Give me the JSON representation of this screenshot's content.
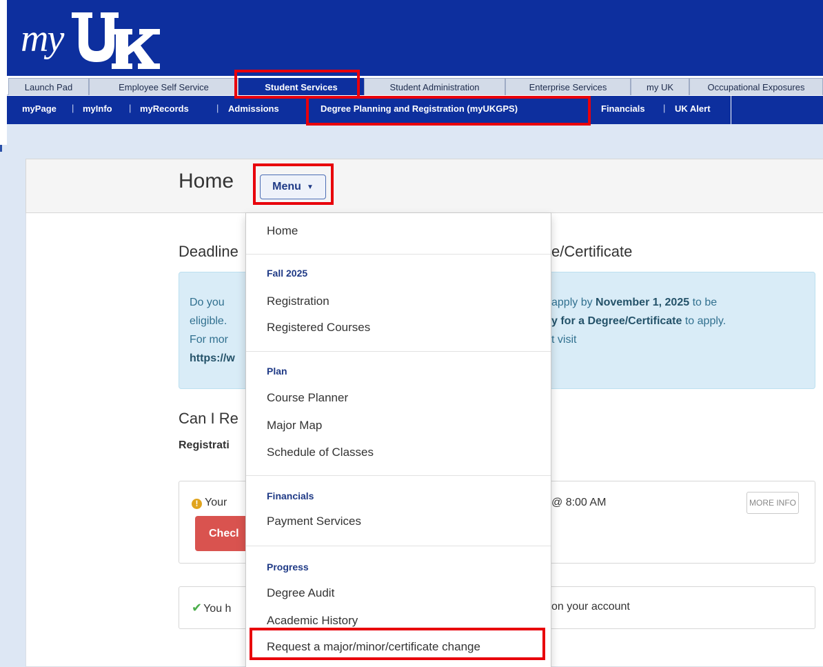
{
  "logo": {
    "prefix": "my",
    "icon": "uk-logo-icon"
  },
  "nav": {
    "tabs": [
      "Launch Pad",
      "Employee Self Service",
      "Student Services",
      "Student Administration",
      "Enterprise Services",
      "my UK",
      "Occupational Exposures"
    ],
    "active_tab": "Student Services",
    "subtabs": [
      "myPage",
      "myInfo",
      "myRecords",
      "Admissions",
      "Degree Planning and Registration (myUKGPS)",
      "Financials",
      "UK Alert"
    ],
    "separator": "|"
  },
  "page": {
    "title": "Home",
    "menu_label": "Menu",
    "deadline_heading_start": "Deadline",
    "deadline_heading_end": "e/Certificate",
    "info_lines_left": [
      "Do you",
      "eligible.",
      "For mor",
      "https://w"
    ],
    "info_line1_right_pre": "apply by ",
    "info_line1_right_bold": "November 1, 2025",
    "info_line1_right_post": " to be",
    "info_line2_right_bold": "y for a Degree/Certificate",
    "info_line2_right_post": " to apply.",
    "info_line3_right": "t visit",
    "can_heading": "Can I Re",
    "registration_label": "Registrati",
    "card1_text": "Your",
    "card1_time": "@ 8:00 AM",
    "more_info_label": "MORE INFO",
    "check_button_label": "Checl",
    "card2_text": "You h",
    "card2_tail": "on your account"
  },
  "dropdown": {
    "home": "Home",
    "sections": [
      {
        "heading": "Fall 2025",
        "items": [
          "Registration",
          "Registered Courses"
        ]
      },
      {
        "heading": "Plan",
        "items": [
          "Course Planner",
          "Major Map",
          "Schedule of Classes"
        ]
      },
      {
        "heading": "Financials",
        "items": [
          "Payment Services"
        ]
      },
      {
        "heading": "Progress",
        "items": [
          "Degree Audit",
          "Academic History",
          "Request a major/minor/certificate change"
        ]
      }
    ]
  },
  "colors": {
    "header_blue": "#0d2f9e",
    "highlight_red": "#e8000b",
    "info_bg": "#d9ecf7",
    "danger_button": "#d9534f"
  }
}
